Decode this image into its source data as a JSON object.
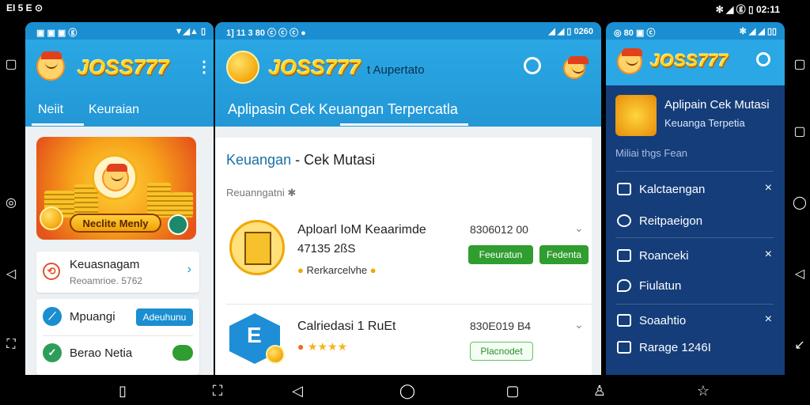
{
  "system_bar": {
    "left_text": "EI 5 E ⊙",
    "right_text": "✻ ◢ ⓖ ▯ 02:11"
  },
  "panel1": {
    "status_left": "▣ ▣ ▣ ⓖ",
    "status_right": "▼◢▲ ▯",
    "brand": "JOSS777",
    "tabs": [
      "Neiit",
      "Keuraian"
    ],
    "banner_button": "Neclite Menly",
    "rows": [
      {
        "title": "Keuasnagam",
        "sub": "Reoamrioe. 5762"
      },
      {
        "title": "Mpuangi",
        "button": "Adeuhunu"
      },
      {
        "title": "Berao Netia"
      }
    ]
  },
  "panel2": {
    "status_left": "1]  11  3  80  ⓒ  ⓒ  ⓒ  ●",
    "status_right": "◢ ◢ ▯ 0260",
    "brand": "JOSS777",
    "brand_sub": "t Aupertato",
    "tagline": "Aplipasin Cek Keuangan Terpercatla",
    "section_title": "Keuangan",
    "section_title_rest": " - Cek Mutasi",
    "section_sub": "Reuanngatni ✱",
    "apps": [
      {
        "title": "Aploarl IoM Keaarimde",
        "subtitle": "47135 2ßS",
        "meta": "Rerkarcelvhe",
        "number": "8306012 00",
        "buttons": [
          "Feeuratun",
          "Fedenta"
        ]
      },
      {
        "title": "Calriedasi 1 RuEt",
        "number": "830E019 B4",
        "button": "Placnodet",
        "rating": "★★★★"
      }
    ]
  },
  "panel3": {
    "status_left": "◎ 80 ▣ ⓒ",
    "status_right": "✻ ◢ ◢ ▯▯",
    "brand": "JOSS777",
    "app_title": "Aplipain Cek Mutasi",
    "app_sub": "Keuanga Terpetia",
    "section": "Miliai thgs Fean",
    "items": [
      "Kalctaengan",
      "Reitpaeigon",
      "Roanceki",
      "Fiulatun",
      "Soaahtio",
      "Rarage 1246I"
    ]
  },
  "colors": {
    "accent": "#1a8ed0",
    "brand_gold": "#ffd628",
    "drawer_bg": "#153d7a",
    "green": "#2f9d2f"
  }
}
